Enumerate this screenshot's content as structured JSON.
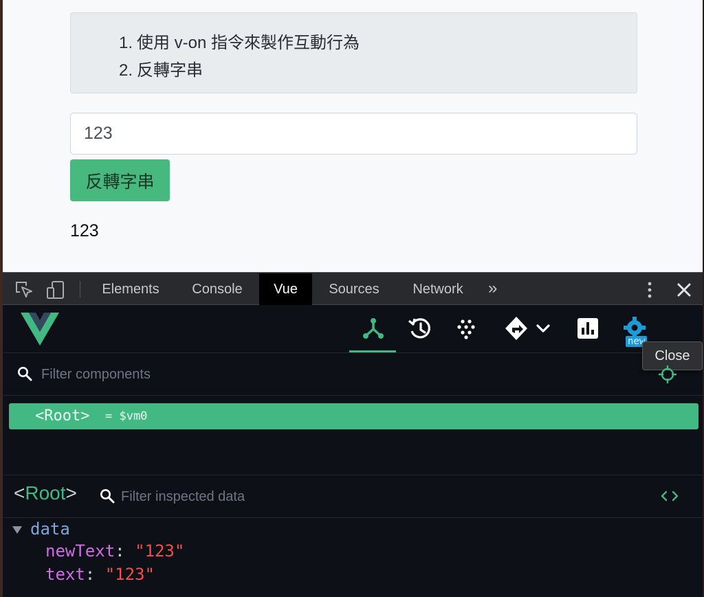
{
  "page": {
    "task_items": [
      {
        "num": "1.",
        "text": "使用 v-on 指令來製作互動行為"
      },
      {
        "num": "2.",
        "text": "反轉字串"
      }
    ],
    "input_value": "123",
    "reverse_button_label": "反轉字串",
    "output_text": "123"
  },
  "devtools": {
    "tabs": [
      {
        "label": "Elements",
        "active": false
      },
      {
        "label": "Console",
        "active": false
      },
      {
        "label": "Vue",
        "active": true
      },
      {
        "label": "Sources",
        "active": false
      },
      {
        "label": "Network",
        "active": false
      }
    ],
    "more_tabs_glyph": "»",
    "tooltip": "Close",
    "new_badge": "new",
    "filter_components_placeholder": "Filter components",
    "tree": {
      "root_tag": "<Root>",
      "root_vm": "= $vm0"
    },
    "inspector": {
      "root_open": "<",
      "root_name": "Root",
      "root_close": ">",
      "filter_placeholder": "Filter inspected data",
      "section": "data",
      "props": [
        {
          "key": "newText",
          "value": "\"123\""
        },
        {
          "key": "text",
          "value": "\"123\""
        }
      ]
    },
    "colors": {
      "vue_green": "#42b883",
      "panel_bg": "#0d1117",
      "tabbar_bg": "#292a2d"
    },
    "icons": [
      "inspect-element-icon",
      "device-toolbar-icon",
      "kebab-menu-icon",
      "close-icon",
      "vue-logo",
      "components-tree-icon",
      "timeline-icon",
      "vuex-icon",
      "router-icon",
      "performance-icon",
      "settings-icon",
      "search-icon",
      "target-icon",
      "code-icon"
    ]
  }
}
